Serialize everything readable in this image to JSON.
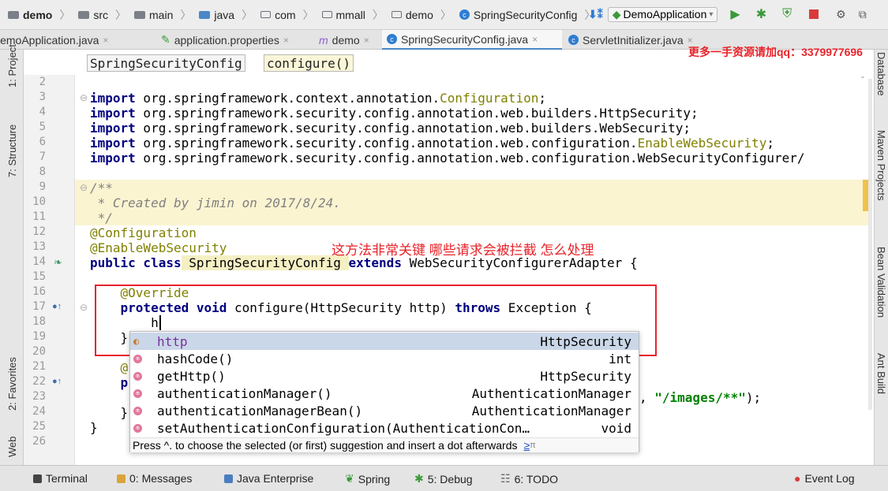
{
  "breadcrumb": [
    "demo",
    "src",
    "main",
    "java",
    "com",
    "mmall",
    "demo",
    "SpringSecurityConfig"
  ],
  "run_config": "DemoApplication",
  "tabs": [
    "DemoApplication.java",
    "application.properties",
    "demo",
    "SpringSecurityConfig.java",
    "ServletInitializer.java"
  ],
  "editor_crumbs": [
    "SpringSecurityConfig",
    "configure()"
  ],
  "promo": "更多一手资源请加qq：3379977696",
  "left_tools": [
    "1: Project",
    "7: Structure",
    "2: Favorites",
    "Web"
  ],
  "right_tools": [
    "Database",
    "Maven Projects",
    "Bean Validation",
    "Ant Build"
  ],
  "line_numbers": [
    "2",
    "3",
    "4",
    "5",
    "6",
    "7",
    "8",
    "9",
    "10",
    "11",
    "12",
    "13",
    "14",
    "15",
    "16",
    "17",
    "18",
    "19",
    "20",
    "21",
    "22",
    "23",
    "24",
    "25",
    "26"
  ],
  "code": {
    "l3a": "import",
    "l3b": " org.springframework.context.annotation.",
    "l3c": "Configuration",
    "l3d": ";",
    "l4a": "import",
    "l4b": " org.springframework.security.config.annotation.web.builders.HttpSecurity;",
    "l5a": "import",
    "l5b": " org.springframework.security.config.annotation.web.builders.WebSecurity;",
    "l6a": "import",
    "l6b": " org.springframework.security.config.annotation.web.configuration.",
    "l6c": "EnableWebSecurity",
    "l6d": ";",
    "l7a": "import",
    "l7b": " org.springframework.security.config.annotation.web.configuration.WebSecurityConfigurer/",
    "l9": "/**",
    "l10": " * Created by jimin on 2017/8/24.",
    "l11": " */",
    "l12": "@Configuration",
    "l13": "@EnableWebSecurity",
    "l14a": "public class",
    "l14b": " SpringSecurityConfig ",
    "l14c": "extends",
    "l14d": " WebSecurityConfigurerAdapter {",
    "l16": "    @Override",
    "l17a": "    protected void",
    "l17b": " configure(HttpSecurity http) ",
    "l17c": "throws",
    "l17d": " Exception {",
    "l18": "        h",
    "l19": "    }",
    "l21": "    @",
    "l22": "    p",
    "l23a": ", ",
    "l23b": "\"/images/**\"",
    "l23c": ");",
    "l24": "    }",
    "l25": "}"
  },
  "annotation_cn": "这方法非常关键  哪些请求会被拦截  怎么处理",
  "completion": {
    "items": [
      {
        "name": "http",
        "type": "HttpSecurity"
      },
      {
        "name": "hashCode()",
        "type": "int"
      },
      {
        "name": "getHttp()",
        "type": "HttpSecurity"
      },
      {
        "name": "authenticationManager()",
        "type": "AuthenticationManager"
      },
      {
        "name": "authenticationManagerBean()",
        "type": "AuthenticationManager"
      },
      {
        "name": "setAuthenticationConfiguration(AuthenticationCon…",
        "type": "void"
      }
    ],
    "hint": "Press ^. to choose the selected (or first) suggestion and insert a dot afterwards",
    "hint_link": "≥",
    "hint_pi": "π"
  },
  "status": [
    "Terminal",
    "0: Messages",
    "Java Enterprise",
    "Spring",
    "5: Debug",
    "6: TODO",
    "Event Log"
  ]
}
